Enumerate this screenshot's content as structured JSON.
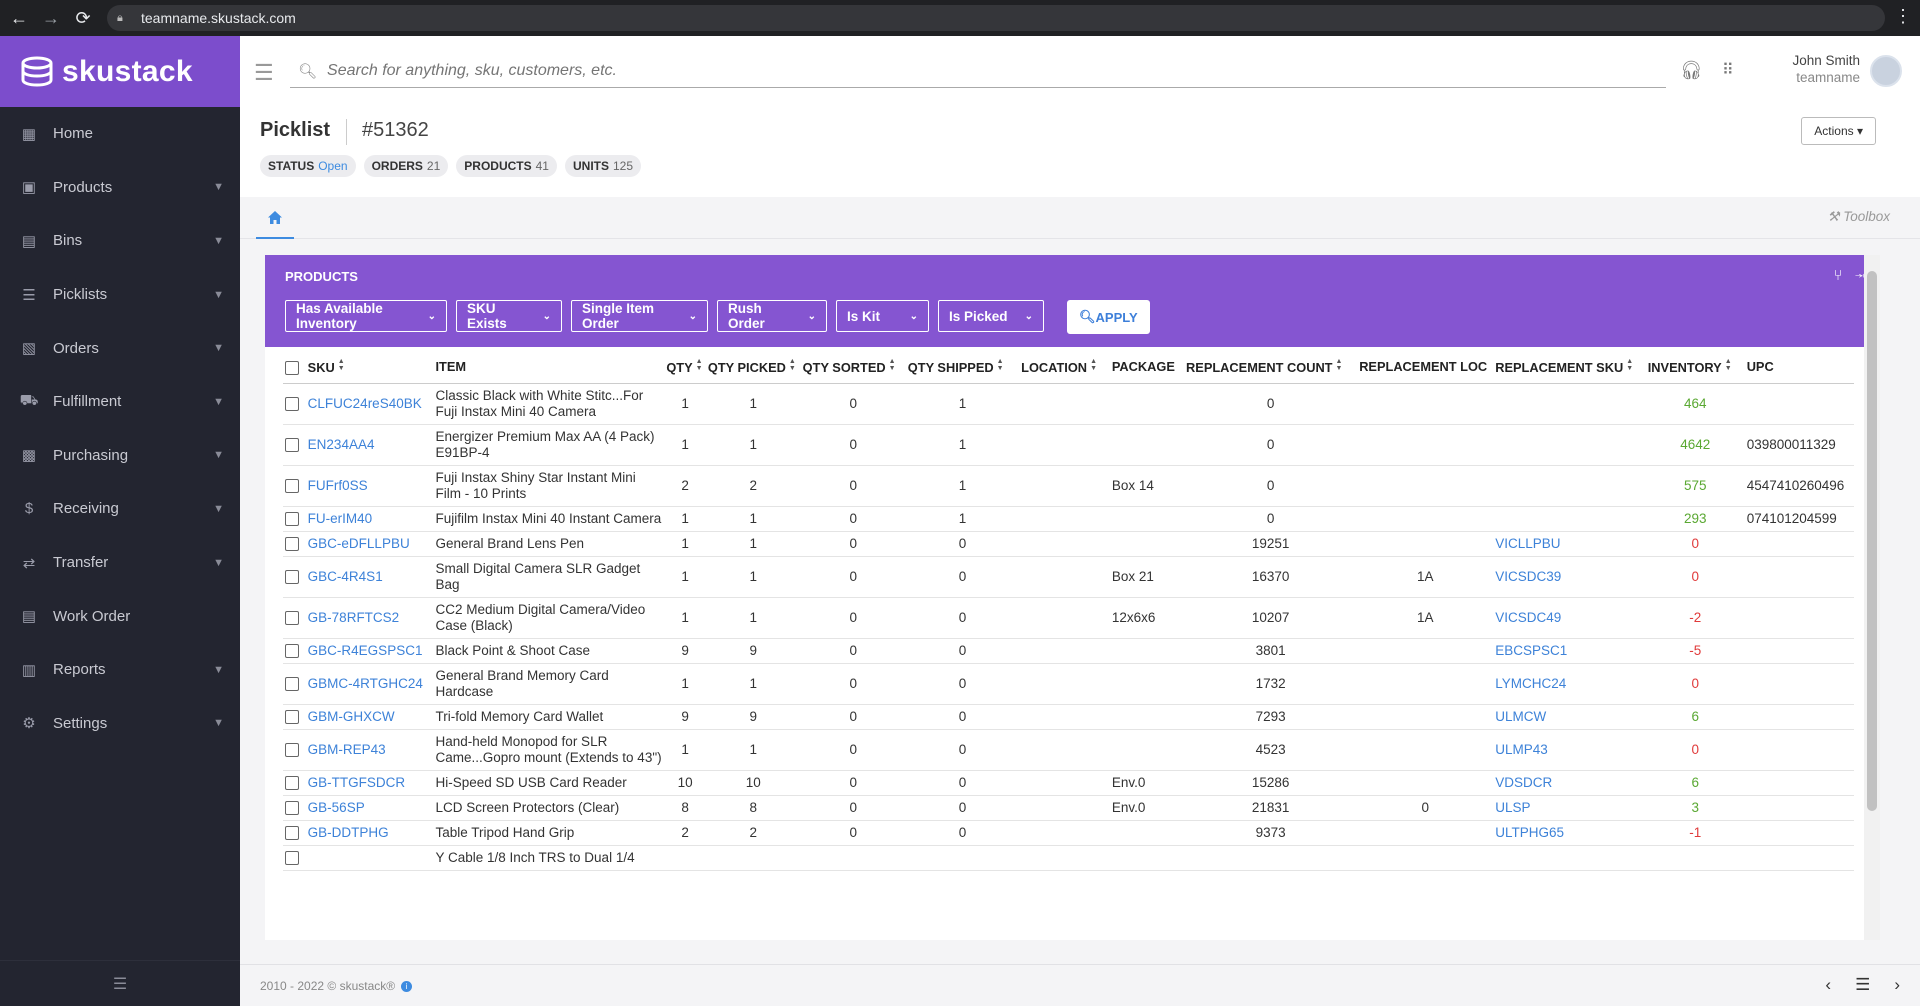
{
  "browser": {
    "url": "teamname.skustack.com"
  },
  "app": {
    "logo_text": "skustack"
  },
  "sidebar": {
    "items": [
      {
        "label": "Home",
        "icon": "dashboard-icon",
        "expandable": false
      },
      {
        "label": "Products",
        "icon": "boxes-icon",
        "expandable": true
      },
      {
        "label": "Bins",
        "icon": "list-box-icon",
        "expandable": true
      },
      {
        "label": "Picklists",
        "icon": "list-icon",
        "expandable": true
      },
      {
        "label": "Orders",
        "icon": "clipboard-icon",
        "expandable": true
      },
      {
        "label": "Fulfillment",
        "icon": "truck-icon",
        "expandable": true
      },
      {
        "label": "Purchasing",
        "icon": "bag-icon",
        "expandable": true
      },
      {
        "label": "Receiving",
        "icon": "dollar-box-icon",
        "expandable": true
      },
      {
        "label": "Transfer",
        "icon": "transfer-icon",
        "expandable": true
      },
      {
        "label": "Work Order",
        "icon": "work-order-icon",
        "expandable": false
      },
      {
        "label": "Reports",
        "icon": "chart-icon",
        "expandable": true
      },
      {
        "label": "Settings",
        "icon": "gear-icon",
        "expandable": true
      }
    ]
  },
  "topbar": {
    "search_placeholder": "Search for anything, sku, customers, etc.",
    "user_name": "John Smith",
    "team": "teamname"
  },
  "header": {
    "title": "Picklist",
    "number": "#51362",
    "actions_label": "Actions ▾",
    "pills": [
      {
        "label": "STATUS",
        "value": "Open"
      },
      {
        "label": "ORDERS",
        "value": "21"
      },
      {
        "label": "PRODUCTS",
        "value": "41"
      },
      {
        "label": "UNITS",
        "value": "125"
      }
    ]
  },
  "tabs": {
    "toolbox_label": "Toolbox"
  },
  "card": {
    "title": "PRODUCTS",
    "filters": [
      "Has Available Inventory",
      "SKU Exists",
      "Single Item Order",
      "Rush Order",
      "Is Kit",
      "Is Picked"
    ],
    "apply_label": "APPLY"
  },
  "table": {
    "columns": [
      "SKU",
      "ITEM",
      "QTY",
      "QTY PICKED",
      "QTY SORTED",
      "QTY SHIPPED",
      "LOCATION",
      "PACKAGE",
      "REPLACEMENT COUNT",
      "REPLACEMENT LOC",
      "REPLACEMENT SKU",
      "INVENTORY",
      "UPC"
    ],
    "rows": [
      {
        "sku": "CLFUC24reS40BK",
        "item": "Classic Black with White Stitc...For Fuji Instax Mini 40 Camera",
        "qty": "1",
        "picked": "1",
        "sorted": "0",
        "shipped": "1",
        "location": "",
        "package": "",
        "rcount": "0",
        "rloc": "",
        "rsku": "",
        "inv": "464",
        "upc": ""
      },
      {
        "sku": "EN234AA4",
        "item": "Energizer Premium Max AA (4 Pack) E91BP-4",
        "qty": "1",
        "picked": "1",
        "sorted": "0",
        "shipped": "1",
        "location": "",
        "package": "",
        "rcount": "0",
        "rloc": "",
        "rsku": "",
        "inv": "4642",
        "upc": "039800011329"
      },
      {
        "sku": "FUFrf0SS",
        "item": "Fuji Instax Shiny Star Instant Mini Film - 10 Prints",
        "qty": "2",
        "picked": "2",
        "sorted": "0",
        "shipped": "1",
        "location": "",
        "package": "Box 14",
        "rcount": "0",
        "rloc": "",
        "rsku": "",
        "inv": "575",
        "upc": "4547410260496"
      },
      {
        "sku": "FU-erIM40",
        "item": "Fujifilm Instax Mini 40 Instant Camera",
        "qty": "1",
        "picked": "1",
        "sorted": "0",
        "shipped": "1",
        "location": "",
        "package": "",
        "rcount": "0",
        "rloc": "",
        "rsku": "",
        "inv": "293",
        "upc": "074101204599"
      },
      {
        "sku": "GBC-eDFLLPBU",
        "item": "General Brand Lens Pen",
        "qty": "1",
        "picked": "1",
        "sorted": "0",
        "shipped": "0",
        "location": "",
        "package": "",
        "rcount": "19251",
        "rloc": "",
        "rsku": "VICLLPBU",
        "inv": "0",
        "upc": ""
      },
      {
        "sku": "GBC-4R4S1",
        "item": "Small Digital Camera SLR Gadget Bag",
        "qty": "1",
        "picked": "1",
        "sorted": "0",
        "shipped": "0",
        "location": "",
        "package": "Box 21",
        "rcount": "16370",
        "rloc": "1A",
        "rsku": "VICSDC39",
        "inv": "0",
        "upc": ""
      },
      {
        "sku": "GB-78RFTCS2",
        "item": "CC2 Medium Digital Camera/Video Case (Black)",
        "qty": "1",
        "picked": "1",
        "sorted": "0",
        "shipped": "0",
        "location": "",
        "package": "12x6x6",
        "rcount": "10207",
        "rloc": "1A",
        "rsku": "VICSDC49",
        "inv": "-2",
        "upc": ""
      },
      {
        "sku": "GBC-R4EGSPSC1",
        "item": "Black Point & Shoot Case",
        "qty": "9",
        "picked": "9",
        "sorted": "0",
        "shipped": "0",
        "location": "",
        "package": "",
        "rcount": "3801",
        "rloc": "",
        "rsku": "EBCSPSC1",
        "inv": "-5",
        "upc": ""
      },
      {
        "sku": "GBMC-4RTGHC24",
        "item": "General Brand Memory Card Hardcase",
        "qty": "1",
        "picked": "1",
        "sorted": "0",
        "shipped": "0",
        "location": "",
        "package": "",
        "rcount": "1732",
        "rloc": "",
        "rsku": "LYMCHC24",
        "inv": "0",
        "upc": ""
      },
      {
        "sku": "GBM-GHXCW",
        "item": "Tri-fold Memory Card Wallet",
        "qty": "9",
        "picked": "9",
        "sorted": "0",
        "shipped": "0",
        "location": "",
        "package": "",
        "rcount": "7293",
        "rloc": "",
        "rsku": "ULMCW",
        "inv": "6",
        "upc": ""
      },
      {
        "sku": "GBM-REP43",
        "item": "Hand-held Monopod for SLR Came...Gopro mount (Extends to 43\")",
        "qty": "1",
        "picked": "1",
        "sorted": "0",
        "shipped": "0",
        "location": "",
        "package": "",
        "rcount": "4523",
        "rloc": "",
        "rsku": "ULMP43",
        "inv": "0",
        "upc": ""
      },
      {
        "sku": "GB-TTGFSDCR",
        "item": "Hi-Speed SD USB Card Reader",
        "qty": "10",
        "picked": "10",
        "sorted": "0",
        "shipped": "0",
        "location": "",
        "package": "Env.0",
        "rcount": "15286",
        "rloc": "",
        "rsku": "VDSDCR",
        "inv": "6",
        "upc": ""
      },
      {
        "sku": "GB-56SP",
        "item": "LCD Screen Protectors (Clear)",
        "qty": "8",
        "picked": "8",
        "sorted": "0",
        "shipped": "0",
        "location": "",
        "package": "Env.0",
        "rcount": "21831",
        "rloc": "0",
        "rsku": "ULSP",
        "inv": "3",
        "upc": ""
      },
      {
        "sku": "GB-DDTPHG",
        "item": "Table Tripod Hand Grip",
        "qty": "2",
        "picked": "2",
        "sorted": "0",
        "shipped": "0",
        "location": "",
        "package": "",
        "rcount": "9373",
        "rloc": "",
        "rsku": "ULTPHG65",
        "inv": "-1",
        "upc": ""
      },
      {
        "sku": "",
        "item": "Y Cable 1/8 Inch TRS to Dual 1/4",
        "qty": "",
        "picked": "",
        "sorted": "",
        "shipped": "",
        "location": "",
        "package": "",
        "rcount": "",
        "rloc": "",
        "rsku": "",
        "inv": "",
        "upc": ""
      }
    ]
  },
  "footer": {
    "copyright": "2010 - 2022 © skustack®"
  },
  "colors": {
    "brand": "#7c4dcc",
    "card_header": "#8555d1",
    "link": "#3d82d8",
    "positive": "#5aa832",
    "negative": "#e03a3a",
    "sidebar": "#232530"
  }
}
